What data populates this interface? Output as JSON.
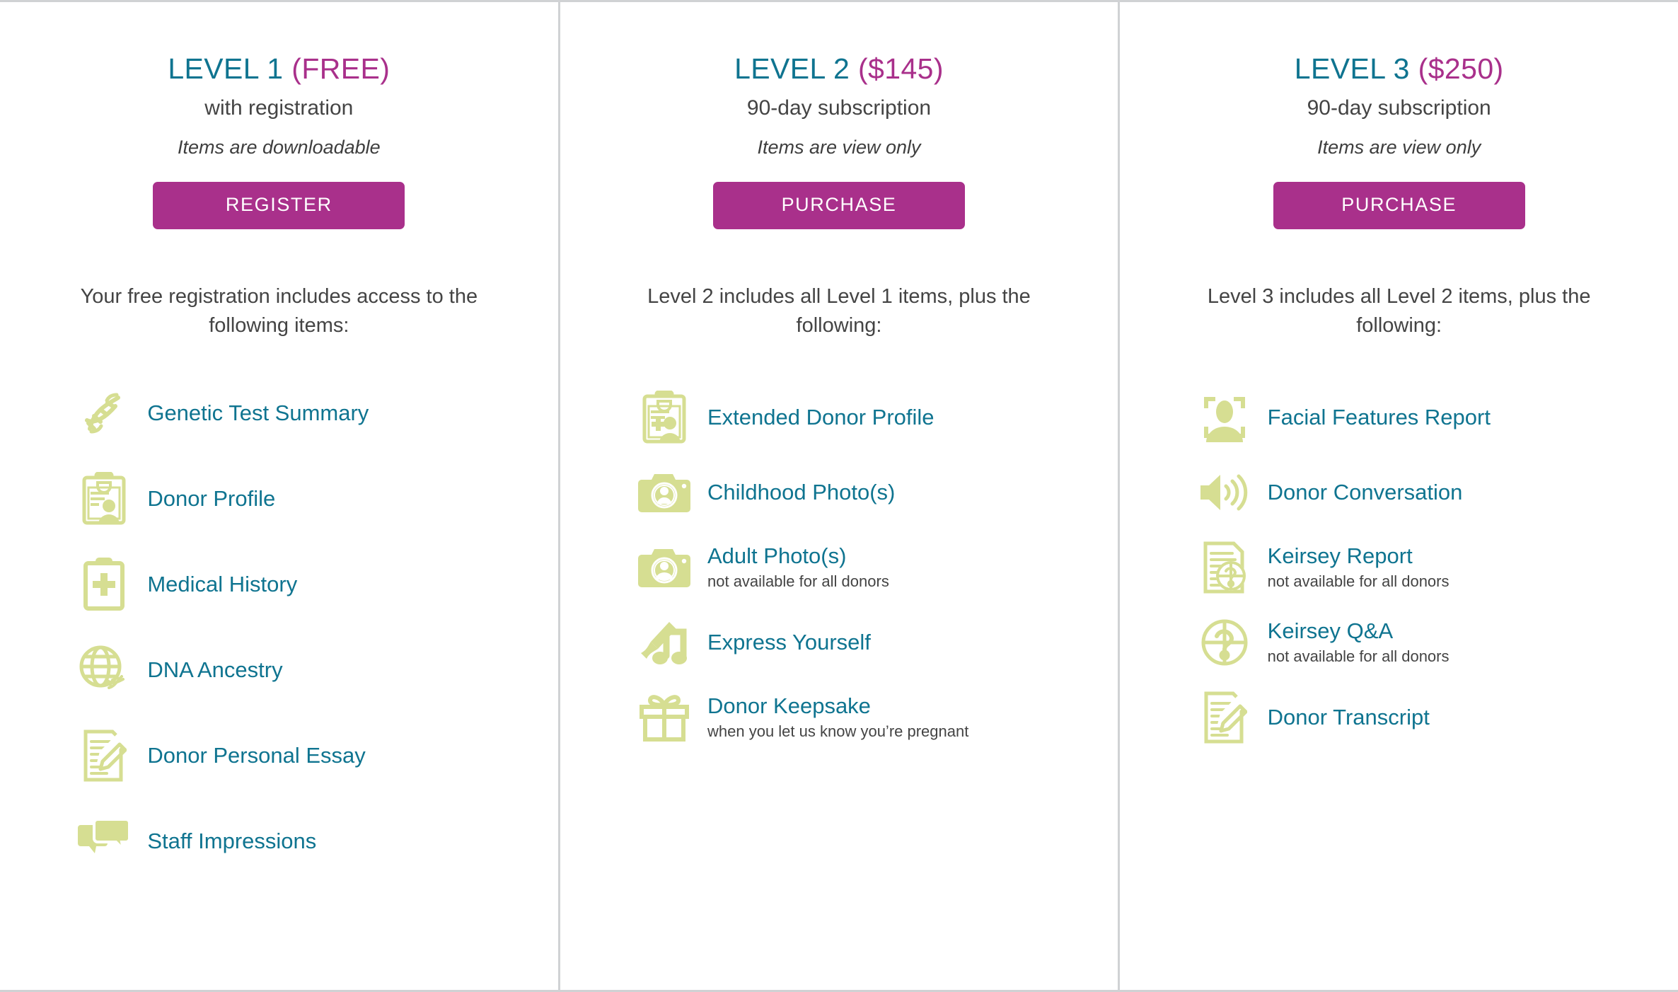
{
  "colors": {
    "teal": "#0f7490",
    "magenta": "#a9308b",
    "icon_green": "#d6de92",
    "body_text": "#444444",
    "divider": "#d0d2d4"
  },
  "tiers": [
    {
      "id": "level-1",
      "name": "LEVEL 1",
      "price": "(FREE)",
      "subtitle": "with registration",
      "note": "Items are downloadable",
      "cta_label": "REGISTER",
      "intro": "Your free registration includes access to the following items:",
      "items": [
        {
          "label": "Genetic Test Summary",
          "note": "",
          "icon": "dna-helix-icon"
        },
        {
          "label": "Donor Profile",
          "note": "",
          "icon": "clipboard-person-icon"
        },
        {
          "label": "Medical History",
          "note": "",
          "icon": "clipboard-medical-cross-icon"
        },
        {
          "label": "DNA Ancestry",
          "note": "",
          "icon": "globe-dna-icon"
        },
        {
          "label": "Donor Personal Essay",
          "note": "",
          "icon": "document-pencil-icon"
        },
        {
          "label": "Staff Impressions",
          "note": "",
          "icon": "speech-bubbles-icon"
        }
      ]
    },
    {
      "id": "level-2",
      "name": "LEVEL 2",
      "price": "($145)",
      "subtitle": "90-day subscription",
      "note": "Items are view only",
      "cta_label": "PURCHASE",
      "intro": "Level 2 includes all Level 1 items, plus the following:",
      "items": [
        {
          "label": "Extended Donor Profile",
          "note": "",
          "icon": "clipboard-person-medical-icon"
        },
        {
          "label": "Childhood Photo(s)",
          "note": "",
          "icon": "camera-portrait-icon"
        },
        {
          "label": "Adult Photo(s)",
          "note": "not available for all donors",
          "icon": "camera-portrait-icon"
        },
        {
          "label": "Express Yourself",
          "note": "",
          "icon": "paintbrush-music-note-icon"
        },
        {
          "label": "Donor Keepsake",
          "note": "when you let us know you’re pregnant",
          "icon": "gift-box-icon"
        }
      ]
    },
    {
      "id": "level-3",
      "name": "LEVEL 3",
      "price": "($250)",
      "subtitle": "90-day subscription",
      "note": "Items are view only",
      "cta_label": "PURCHASE",
      "intro": "Level 3 includes all Level 2 items, plus the following:",
      "items": [
        {
          "label": "Facial Features Report",
          "note": "",
          "icon": "face-detection-icon"
        },
        {
          "label": "Donor Conversation",
          "note": "",
          "icon": "speaker-sound-icon"
        },
        {
          "label": "Keirsey Report",
          "note": "not available for all donors",
          "icon": "document-question-icon"
        },
        {
          "label": "Keirsey Q&A",
          "note": "not available for all donors",
          "icon": "circle-question-icon"
        },
        {
          "label": "Donor Transcript",
          "note": "",
          "icon": "document-pencil-icon"
        }
      ]
    }
  ]
}
